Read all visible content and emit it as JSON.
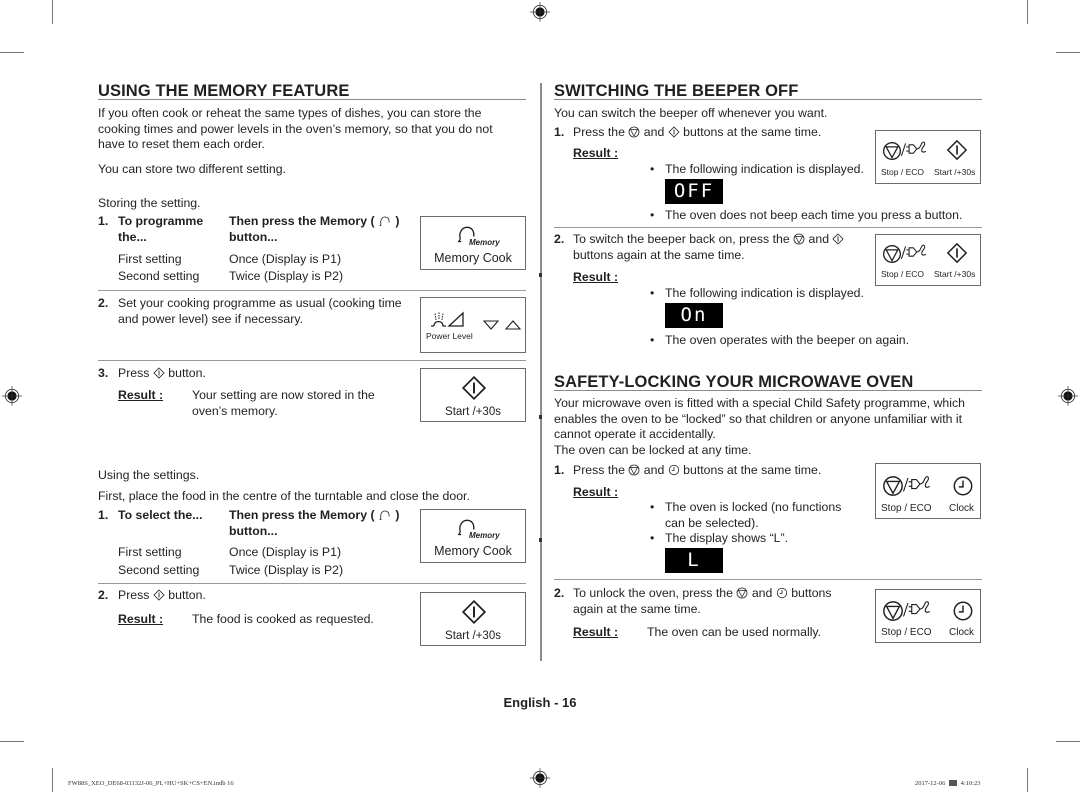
{
  "left": {
    "heading": "USING THE MEMORY FEATURE",
    "intro": [
      "If you often cook or reheat the same types of dishes, you can store the",
      "cooking times and power levels in the oven’s memory, so that you do not",
      "have to reset them each order."
    ],
    "store_two": "You can store two different setting.",
    "storing_label": "Storing the setting.",
    "store_step1": {
      "num": "1.",
      "col1_header": [
        "To programme",
        "the..."
      ],
      "col2_header_a": "Then press the Memory (",
      "col2_header_b": ")",
      "col2_header_line2": "button...",
      "rows": [
        {
          "setting": "First setting",
          "press": "Once (Display is P1)"
        },
        {
          "setting": "Second setting",
          "press": "Twice (Display is P2)"
        }
      ],
      "panel": {
        "icon_text": "Memory",
        "label": "Memory Cook"
      }
    },
    "store_step2": {
      "num": "2.",
      "text": [
        "Set your cooking programme as usual (cooking time",
        "and power level) see if necessary."
      ],
      "panel": {
        "label": "Power Level"
      }
    },
    "store_step3": {
      "num": "3.",
      "text_a": "Press",
      "text_b": "button.",
      "result_label": "Result :",
      "result_text": [
        "Your setting are now stored in the",
        "oven’s memory."
      ],
      "panel": {
        "label": "Start /+30s"
      }
    },
    "using_label": "Using the settings.",
    "using_intro": "First, place the food in the centre of the turntable and close the door.",
    "use_step1": {
      "num": "1.",
      "col1_header": [
        "To select the..."
      ],
      "col2_header_a": "Then press the Memory (",
      "col2_header_b": ")",
      "col2_header_line2": "button...",
      "rows": [
        {
          "setting": "First setting",
          "press": "Once (Display is P1)"
        },
        {
          "setting": "Second setting",
          "press": "Twice (Display is P2)"
        }
      ],
      "panel": {
        "icon_text": "Memory",
        "label": "Memory Cook"
      }
    },
    "use_step2": {
      "num": "2.",
      "text_a": "Press",
      "text_b": "button.",
      "result_label": "Result :",
      "result_text": "The food is cooked as requested.",
      "panel": {
        "label": "Start /+30s"
      }
    }
  },
  "right": {
    "beeper": {
      "heading": "SWITCHING THE BEEPER OFF",
      "intro": "You can switch the beeper off whenever you want.",
      "step1": {
        "num": "1.",
        "text_a": "Press the",
        "text_b": "and",
        "text_c": "buttons at the same time.",
        "result_label": "Result :",
        "bullet1": "The following indication is displayed.",
        "display": "OFF",
        "bullet2": "The oven does not beep each time you press a button.",
        "panel": {
          "left_label": "Stop / ECO",
          "right_label": "Start /+30s"
        }
      },
      "step2": {
        "num": "2.",
        "text_a": "To switch the beeper back on, press the",
        "text_b": "and",
        "text_c": "buttons again at the same time.",
        "result_label": "Result :",
        "bullet1": "The following indication is displayed.",
        "display": "On",
        "bullet2": "The oven operates with the beeper on again.",
        "panel": {
          "left_label": "Stop / ECO",
          "right_label": "Start /+30s"
        }
      }
    },
    "lock": {
      "heading": "SAFETY-LOCKING YOUR MICROWAVE OVEN",
      "intro": [
        "Your microwave oven is fitted with a special Child Safety programme, which",
        "enables the oven to be “locked” so that children or anyone unfamiliar with it",
        "cannot operate it accidentally."
      ],
      "anytime": "The oven can be locked at any time.",
      "step1": {
        "num": "1.",
        "text_a": "Press the",
        "text_b": "and",
        "text_c": "buttons at the same time.",
        "result_label": "Result :",
        "bullet1": [
          "The oven is locked (no functions",
          "can be selected)."
        ],
        "bullet2": "The display shows “L”.",
        "display": "L",
        "panel": {
          "left_label": "Stop / ECO",
          "right_label": "Clock"
        }
      },
      "step2": {
        "num": "2.",
        "text_a": "To unlock the oven, press the",
        "text_b": "and",
        "text_c": "buttons",
        "text_d": "again at the same time.",
        "result_label": "Result :",
        "result_text": "The oven can be used normally.",
        "panel": {
          "left_label": "Stop / ECO",
          "right_label": "Clock"
        }
      }
    }
  },
  "page_number": "English - 16",
  "footer": {
    "file": "FW88S_XEO_DE68-03132J-06_PL+HU+SK+CS+EN.indb   16",
    "date": "2017-12-06",
    "time": "4:10:23"
  }
}
